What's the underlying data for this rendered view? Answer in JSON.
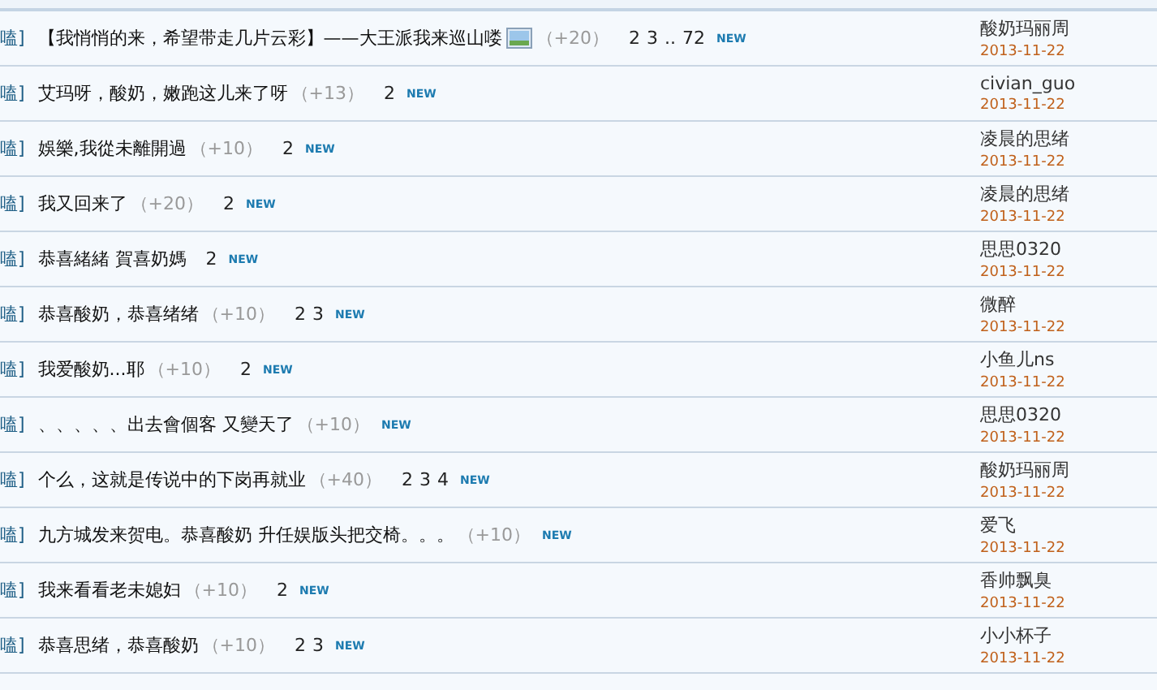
{
  "threads": [
    {
      "category": "嗑]",
      "title": "【我悄悄的来，希望带走几片云彩】——大王派我来巡山喽",
      "has_image": true,
      "replies": "（+20）",
      "pages": [
        "2",
        "3",
        "..",
        "72"
      ],
      "new": "NEW",
      "author": "酸奶玛丽周",
      "date": "2013-11-22"
    },
    {
      "category": "嗑]",
      "title": "艾玛呀，酸奶，嫩跑这儿来了呀",
      "replies": "（+13）",
      "pages": [
        "2"
      ],
      "new": "NEW",
      "author": "civian_guo",
      "date": "2013-11-22"
    },
    {
      "category": "嗑]",
      "title": "娛樂,我從未離開過",
      "replies": "（+10）",
      "pages": [
        "2"
      ],
      "new": "NEW",
      "author": "凌晨的思绪",
      "date": "2013-11-22"
    },
    {
      "category": "嗑]",
      "title": "我又回来了",
      "replies": "（+20）",
      "pages": [
        "2"
      ],
      "new": "NEW",
      "author": "凌晨的思绪",
      "date": "2013-11-22"
    },
    {
      "category": "嗑]",
      "title": "恭喜緒緒  賀喜奶媽",
      "pages": [
        "2"
      ],
      "new": "NEW",
      "author": "思思0320",
      "date": "2013-11-22"
    },
    {
      "category": "嗑]",
      "title": "恭喜酸奶，恭喜绪绪",
      "replies": "（+10）",
      "pages": [
        "2",
        "3"
      ],
      "new": "NEW",
      "author": "微醉",
      "date": "2013-11-22"
    },
    {
      "category": "嗑]",
      "title": "我爱酸奶...耶",
      "replies": "（+10）",
      "pages": [
        "2"
      ],
      "new": "NEW",
      "author": "小鱼儿ns",
      "date": "2013-11-22"
    },
    {
      "category": "嗑]",
      "title": "、、、、、出去會個客 又變天了",
      "replies": "（+10）",
      "new": "NEW",
      "author": "思思0320",
      "date": "2013-11-22"
    },
    {
      "category": "嗑]",
      "title": "个么，这就是传说中的下岗再就业",
      "replies": "（+40）",
      "pages": [
        "2",
        "3",
        "4"
      ],
      "new": "NEW",
      "author": "酸奶玛丽周",
      "date": "2013-11-22"
    },
    {
      "category": "嗑]",
      "title": "九方城发来贺电。恭喜酸奶 升任娱版头把交椅。。。",
      "replies": "（+10）",
      "new": "NEW",
      "author": "爱飞",
      "date": "2013-11-22"
    },
    {
      "category": "嗑]",
      "title": "我来看看老未媳妇",
      "replies": "（+10）",
      "pages": [
        "2"
      ],
      "new": "NEW",
      "author": "香帅飘臭",
      "date": "2013-11-22"
    },
    {
      "category": "嗑]",
      "title": "恭喜思绪，恭喜酸奶",
      "replies": "（+10）",
      "pages": [
        "2",
        "3"
      ],
      "new": "NEW",
      "author": "小小杯子",
      "date": "2013-11-22"
    }
  ]
}
